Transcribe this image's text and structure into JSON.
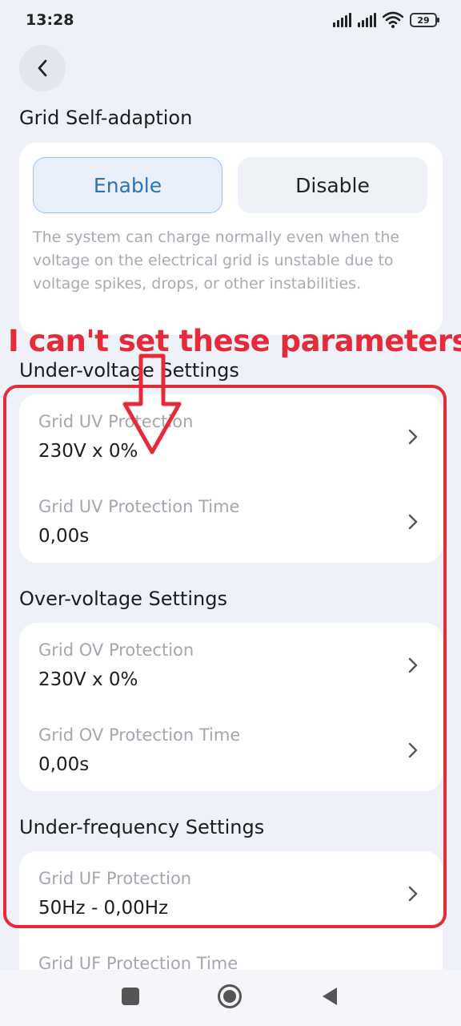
{
  "status_bar": {
    "time": "13:28",
    "battery": "29",
    "icons": [
      "signal-icon",
      "signal-icon",
      "wifi-icon",
      "battery-icon"
    ]
  },
  "back_icon": "chevron-left-icon",
  "grid_self_adaption": {
    "title": "Grid Self-adaption",
    "enable_label": "Enable",
    "disable_label": "Disable",
    "selected": "Enable",
    "description": "The system can charge normally even when the voltage on the electrical grid is unstable due to voltage spikes, drops, or other instabilities."
  },
  "annotation": {
    "text": "I can't set these parameters",
    "color": "#e52b3a"
  },
  "under_voltage": {
    "title": "Under-voltage Settings",
    "items": [
      {
        "label": "Grid UV Protection",
        "value": "230V x 0%"
      },
      {
        "label": "Grid UV Protection Time",
        "value": "0,00s"
      }
    ]
  },
  "over_voltage": {
    "title": "Over-voltage Settings",
    "items": [
      {
        "label": "Grid OV Protection",
        "value": "230V x 0%"
      },
      {
        "label": "Grid OV Protection Time",
        "value": "0,00s"
      }
    ]
  },
  "under_frequency": {
    "title": "Under-frequency Settings",
    "items": [
      {
        "label": "Grid UF Protection",
        "value": "50Hz - 0,00Hz"
      },
      {
        "label": "Grid UF Protection Time",
        "value": ""
      }
    ]
  },
  "colors": {
    "accent": "#2c74b7",
    "background": "#eef1f8",
    "card": "#ffffff",
    "muted_text": "#a5a7ae"
  }
}
